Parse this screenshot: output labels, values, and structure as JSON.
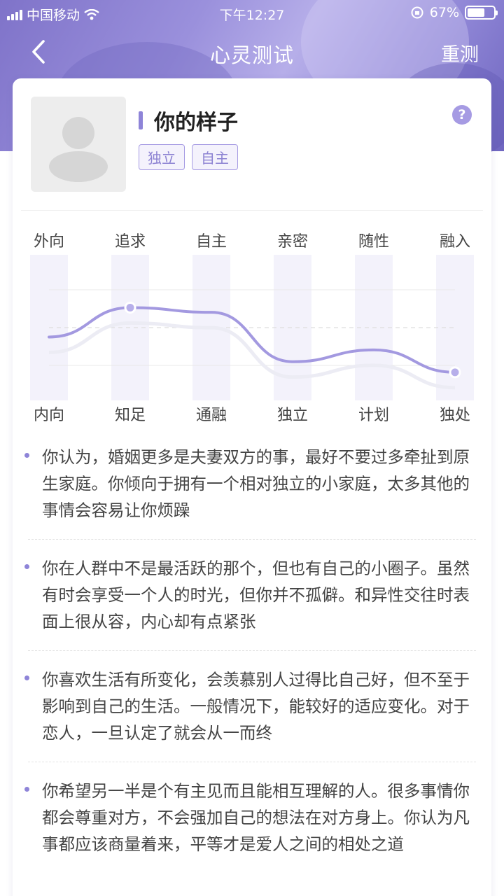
{
  "status_bar": {
    "carrier": "中国移动",
    "time": "下午12:27",
    "battery_percent": "67%",
    "battery_level": 0.67
  },
  "nav": {
    "back_icon": "chevron-left-icon",
    "title": "心灵测试",
    "right_action": "重测"
  },
  "profile": {
    "title": "你的样子",
    "tags": [
      "独立",
      "自主"
    ],
    "help_label": "?"
  },
  "colors": {
    "accent": "#8e84d8",
    "tag_border": "#a69be3",
    "header_gradient_mid": "#b6aee9"
  },
  "chart_data": {
    "type": "line",
    "top_labels": [
      "外向",
      "追求",
      "自主",
      "亲密",
      "随性",
      "融入"
    ],
    "bottom_labels": [
      "内向",
      "知足",
      "通融",
      "独立",
      "计划",
      "独处"
    ],
    "values": [
      0.42,
      0.67,
      0.63,
      0.21,
      0.31,
      0.12
    ],
    "highlighted_points": [
      1,
      5
    ],
    "ylim": [
      0,
      1
    ]
  },
  "descriptions": [
    "你认为，婚姻更多是夫妻双方的事，最好不要过多牵扯到原生家庭。你倾向于拥有一个相对独立的小家庭，太多其他的事情会容易让你烦躁",
    "你在人群中不是最活跃的那个，但也有自己的小圈子。虽然有时会享受一个人的时光，但你并不孤僻。和异性交往时表面上很从容，内心却有点紧张",
    "你喜欢生活有所变化，会羡慕别人过得比自己好，但不至于影响到自己的生活。一般情况下，能较好的适应变化。对于恋人，一旦认定了就会从一而终",
    "你希望另一半是个有主见而且能相互理解的人。很多事情你都会尊重对方，不会强加自己的想法在对方身上。你认为凡事都应该商量着来，平等才是爱人之间的相处之道"
  ]
}
